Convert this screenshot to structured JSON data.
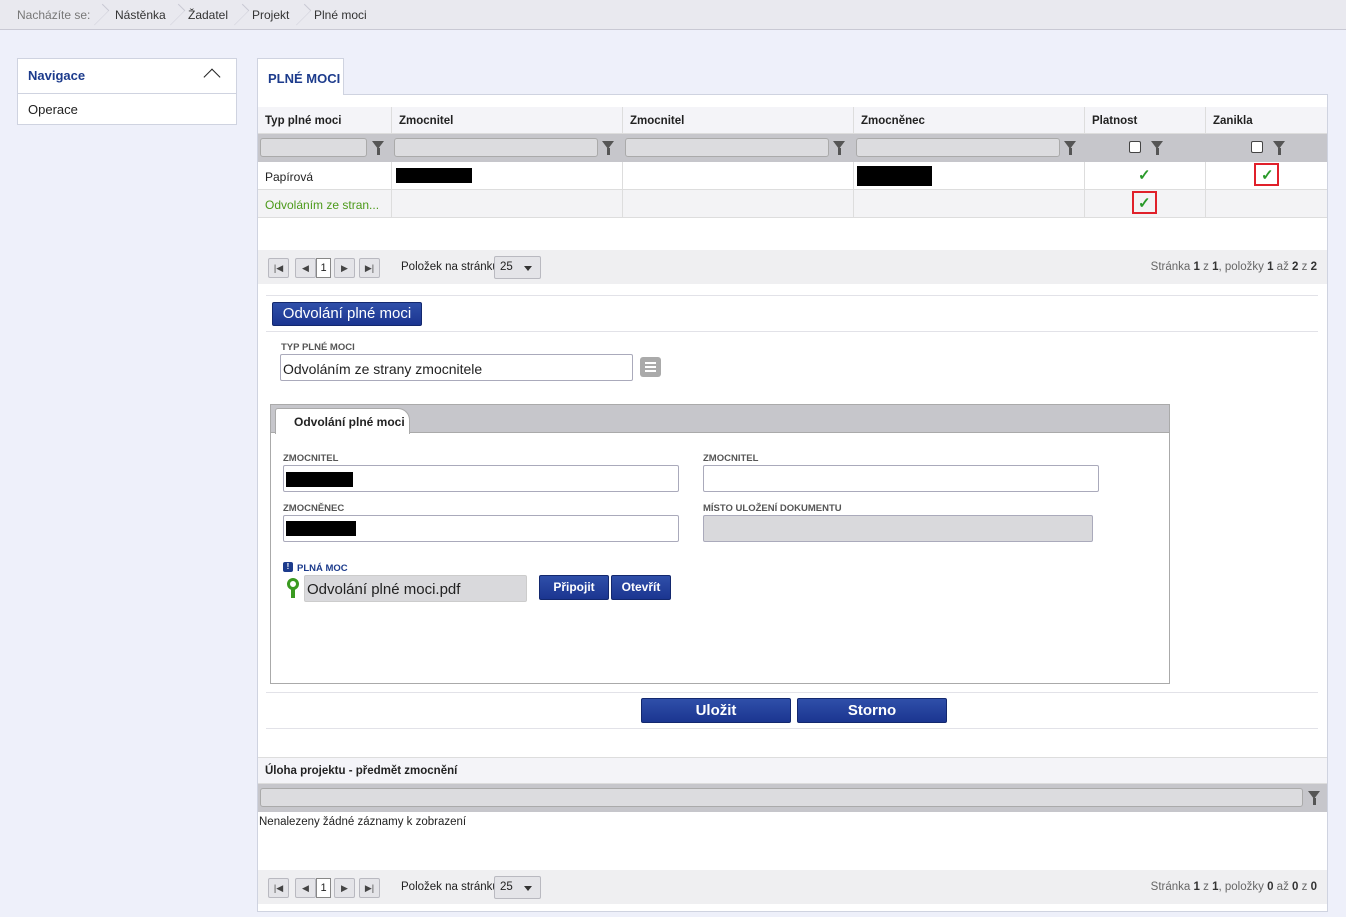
{
  "breadcrumb": {
    "prefix": "Nacházíte se:",
    "items": [
      "Nástěnka",
      "Žadatel",
      "Projekt",
      "Plné moci"
    ]
  },
  "nav": {
    "title": "Navigace",
    "items": [
      "Operace"
    ]
  },
  "page_tab": "PLNÉ MOCI",
  "grid": {
    "columns": [
      "Typ plné moci",
      "Zmocnitel",
      "Zmocnitel",
      "Zmocněnec",
      "Platnost",
      "Zanikla"
    ],
    "rows": [
      {
        "typ": "Papírová",
        "zmocnitel1": "",
        "zmocnitel2": "",
        "zmocnenec": "",
        "platnost": "✓",
        "zanikla": "✓"
      },
      {
        "typ": "Odvoláním ze stran...",
        "zmocnitel1": "",
        "zmocnitel2": "",
        "zmocnenec": "",
        "platnost": "✓",
        "zanikla": ""
      }
    ],
    "pager": {
      "current_page": "1",
      "per_page_label": "Položek na stránku",
      "per_page_value": "25",
      "info_prefix": "Stránka",
      "page": "1",
      "of_word": "z",
      "pages": "1",
      "items_word": ", položky",
      "from": "1",
      "to_word": "až",
      "to": "2",
      "total": "2"
    }
  },
  "detail": {
    "button_label": "Odvolání plné moci",
    "typ_label": "TYP PLNÉ MOCI",
    "typ_value": "Odvoláním ze strany zmocnitele",
    "inner_tab": "Odvolání plné moci",
    "zmocnitel_label": "ZMOCNITEL",
    "zmocnitel2_label": "ZMOCNITEL",
    "zmocnitel2_value": "",
    "zmocnenec_label": "ZMOCNĚNEC",
    "misto_label": "MÍSTO ULOŽENÍ DOKUMENTU",
    "misto_value": "",
    "plna_moc_label": "PLNÁ MOC",
    "file_name": "Odvolání plné moci.pdf",
    "attach_label": "Připojit",
    "open_label": "Otevřít",
    "save_label": "Uložit",
    "cancel_label": "Storno"
  },
  "task_grid": {
    "column": "Úloha projektu - předmět zmocnění",
    "empty_text": "Nenalezeny žádné záznamy k zobrazení",
    "pager": {
      "current_page": "1",
      "per_page_label": "Položek na stránku",
      "per_page_value": "25",
      "info_prefix": "Stránka",
      "page": "1",
      "of_word": "z",
      "pages": "1",
      "items_word": ", položky",
      "from": "0",
      "to_word": "až",
      "to": "0",
      "total": "0"
    }
  },
  "colors": {
    "accent": "#1c3b8c",
    "check": "#2a9a2a",
    "highlight": "#e0202a"
  },
  "icons": [
    "chevron-up-icon",
    "filter-icon",
    "check-icon",
    "list-icon",
    "certificate-icon",
    "info-icon"
  ]
}
